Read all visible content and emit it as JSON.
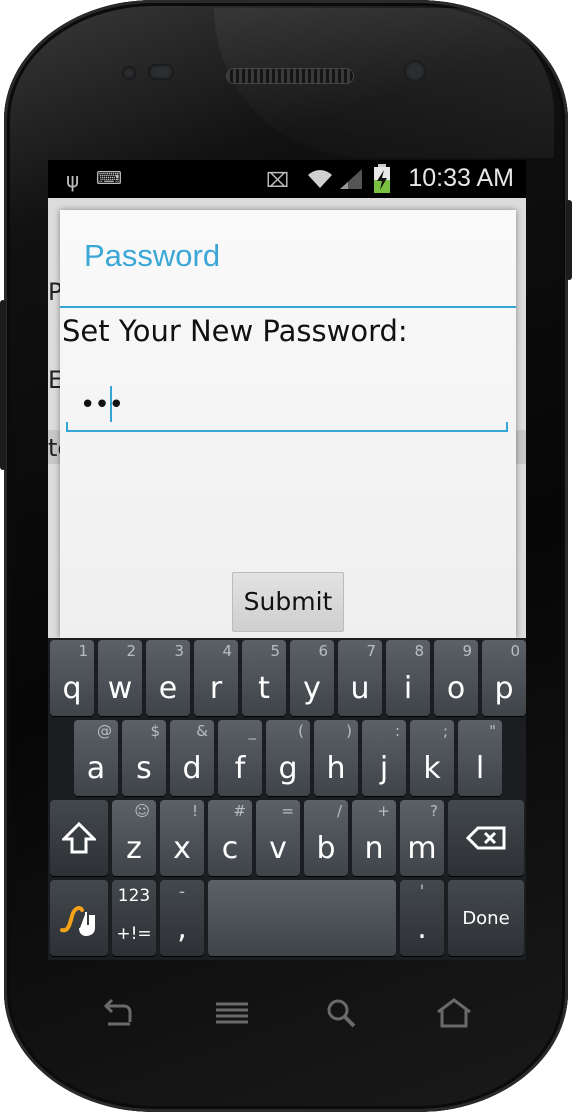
{
  "status_bar": {
    "time": "10:33 AM",
    "icons": [
      "usb-icon",
      "keyboard-icon",
      "vibrate-icon",
      "wifi-icon",
      "signal-icon",
      "battery-charging-icon"
    ]
  },
  "background_app": {
    "row1": "P",
    "row2": "E",
    "row3": "te"
  },
  "dialog": {
    "title": "Password",
    "message": "Set Your New Password:",
    "password_value": "•••",
    "submit_label": "Submit"
  },
  "keyboard": {
    "row1": [
      {
        "key": "q",
        "hint": "1"
      },
      {
        "key": "w",
        "hint": "2"
      },
      {
        "key": "e",
        "hint": "3"
      },
      {
        "key": "r",
        "hint": "4"
      },
      {
        "key": "t",
        "hint": "5"
      },
      {
        "key": "y",
        "hint": "6"
      },
      {
        "key": "u",
        "hint": "7"
      },
      {
        "key": "i",
        "hint": "8"
      },
      {
        "key": "o",
        "hint": "9"
      },
      {
        "key": "p",
        "hint": "0"
      }
    ],
    "row2": [
      {
        "key": "a",
        "hint": "@"
      },
      {
        "key": "s",
        "hint": "$"
      },
      {
        "key": "d",
        "hint": "&"
      },
      {
        "key": "f",
        "hint": "_"
      },
      {
        "key": "g",
        "hint": "("
      },
      {
        "key": "h",
        "hint": ")"
      },
      {
        "key": "j",
        "hint": ":"
      },
      {
        "key": "k",
        "hint": ";"
      },
      {
        "key": "l",
        "hint": "\""
      }
    ],
    "row3": [
      {
        "key": "z",
        "hint": "☺"
      },
      {
        "key": "x",
        "hint": "!"
      },
      {
        "key": "c",
        "hint": "#"
      },
      {
        "key": "v",
        "hint": "="
      },
      {
        "key": "b",
        "hint": "/"
      },
      {
        "key": "n",
        "hint": "+"
      },
      {
        "key": "m",
        "hint": "?"
      }
    ],
    "symbols_top": "123",
    "symbols_bottom": "+!=",
    "comma": ",",
    "comma_hint": "-",
    "period": ".",
    "period_hint": "'",
    "done": "Done"
  },
  "colors": {
    "accent": "#35a5d5",
    "swype": "#f5a21b"
  }
}
